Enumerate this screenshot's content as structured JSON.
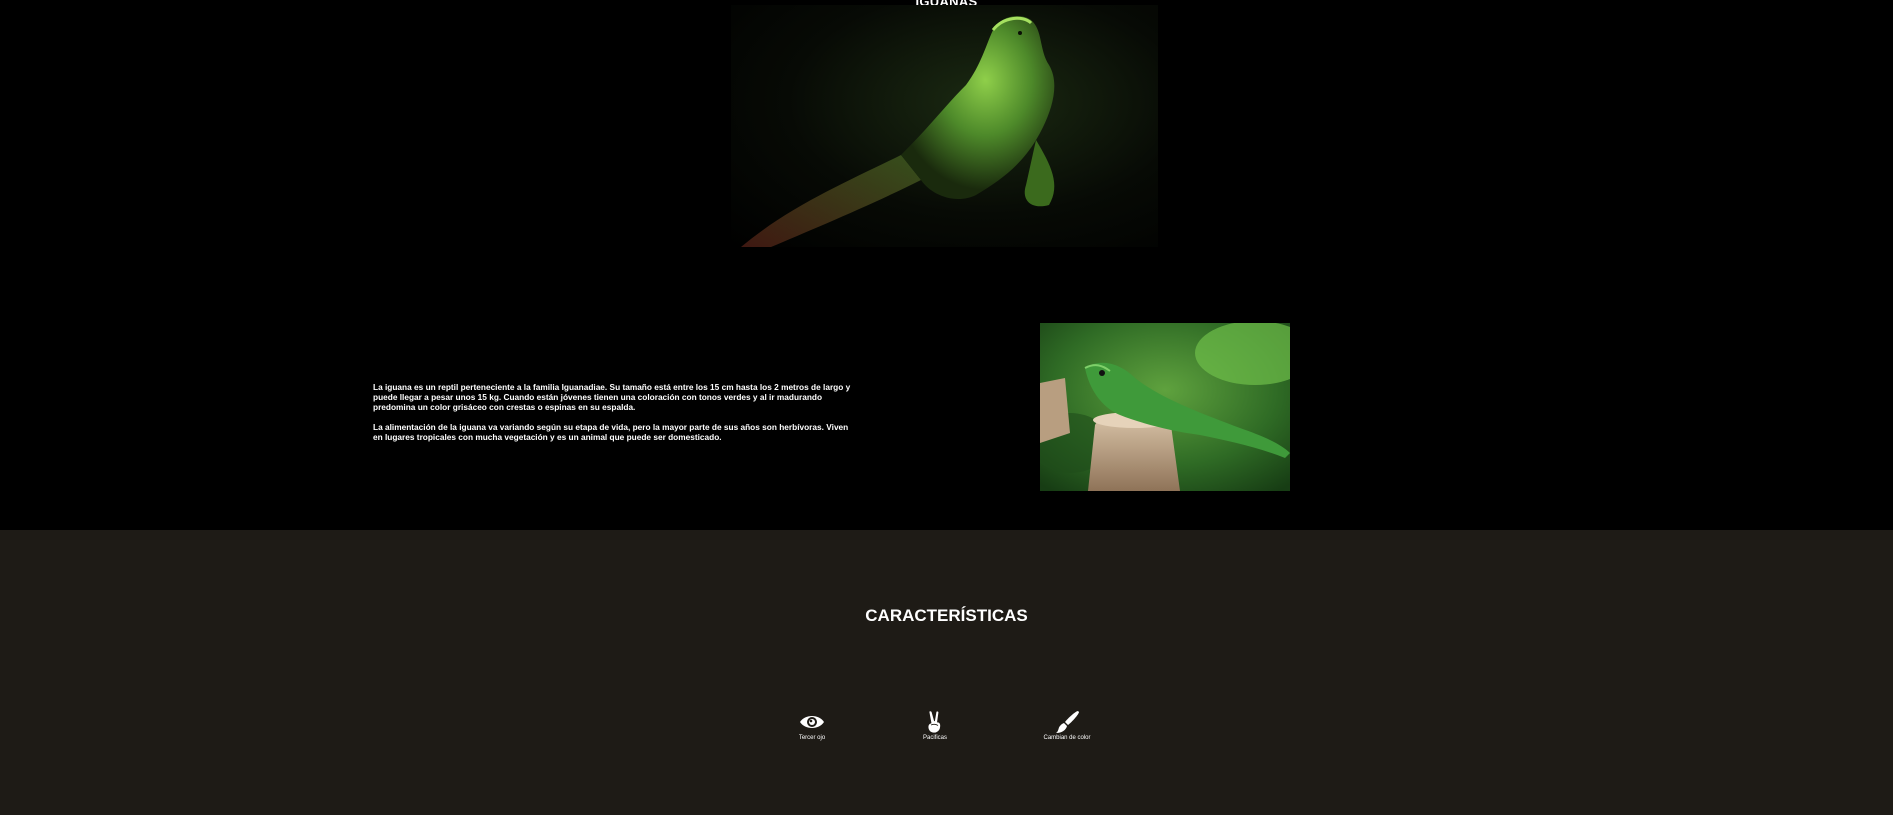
{
  "page": {
    "title": "IGUANAS"
  },
  "intro": {
    "paragraph_1": "La iguana es un reptil perteneciente a la familia Iguanadiae. Su tamaño está entre los 15 cm hasta los 2 metros de largo y puede llegar a pesar unos 15 kg. Cuando están jóvenes tienen una coloración con tonos verdes y al ir madurando predomina un color grisáceo con crestas o espinas en su espalda.",
    "paragraph_2": "La alimentación de la iguana va variando según su etapa de vida, pero la mayor parte de sus años son herbívoras. Viven en lugares tropicales con mucha vegetación y es un animal que puede ser domesticado."
  },
  "features": {
    "title": "CARACTERÍSTICAS",
    "items": [
      {
        "label": "Tercer ojo",
        "icon": "eye-icon"
      },
      {
        "label": "Pacificas",
        "icon": "peace-hand-icon"
      },
      {
        "label": "Cambian de color",
        "icon": "paint-brush-icon"
      }
    ]
  },
  "colors": {
    "top_background": "#000000",
    "features_background": "#1e1b16",
    "text": "#ffffff"
  }
}
